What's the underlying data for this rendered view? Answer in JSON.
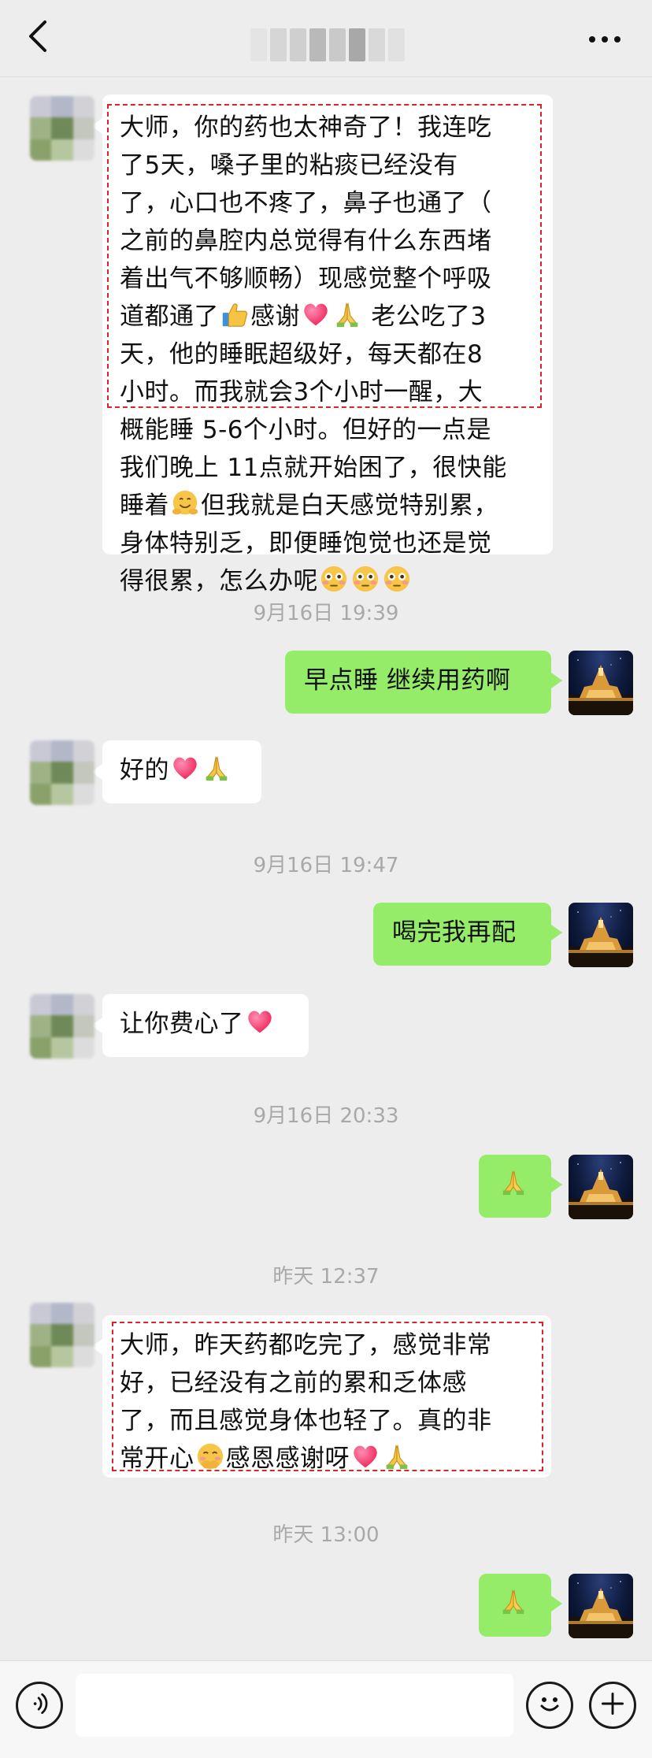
{
  "header": {
    "back_icon": "chevron-left-icon",
    "more_icon": "more-dots-icon",
    "title_blur_colors": [
      "#e4e4e4",
      "#d6d6d6",
      "#cfcfcf",
      "#b9b9b9",
      "#c9c9c9",
      "#a8a8a8",
      "#d9d9d9",
      "#e1e1e1"
    ]
  },
  "colors": {
    "incoming_bubble": "#ffffff",
    "outgoing_bubble": "#95ec69",
    "highlight_box": "#d8242b",
    "timestamp": "#a9a9a9",
    "background": "#ededed"
  },
  "messages": [
    {
      "direction": "in",
      "text_lines": [
        "大师，你的药也太神奇了！我连吃",
        "了5天，嗓子里的粘痰已经没有",
        "了，心口也不疼了，鼻子也通了（",
        "之前的鼻腔内总觉得有什么东西堵",
        "着出气不够顺畅）现感觉整个呼吸",
        "道都通了[thumbs-up]感谢[heart][pray] 老公吃了3",
        "天，他的睡眠超级好，每天都在8",
        "小时。而我就会3个小时一醒，大",
        "概能睡 5-6个小时。但好的一点是",
        "我们晚上 11点就开始困了，很快能",
        "睡着[hug]但我就是白天感觉特别累，",
        "身体特别乏，即便睡饱觉也还是觉",
        "得很累，怎么办呢[flushed][flushed][flushed]"
      ]
    },
    {
      "direction": "timestamp",
      "text": "9月16日 19:39"
    },
    {
      "direction": "out",
      "text": "早点睡 继续用药啊"
    },
    {
      "direction": "in",
      "text": "好的[heart][pray]"
    },
    {
      "direction": "timestamp",
      "text": "9月16日 19:47"
    },
    {
      "direction": "out",
      "text": "喝完我再配"
    },
    {
      "direction": "in",
      "text": "让你费心了[heart]"
    },
    {
      "direction": "timestamp",
      "text": "9月16日 20:33"
    },
    {
      "direction": "out",
      "text": "[pray]"
    },
    {
      "direction": "timestamp",
      "text": "昨天 12:37"
    },
    {
      "direction": "in",
      "text_lines": [
        "大师，昨天药都吃完了，感觉非常",
        "好，已经没有之前的累和乏体感",
        "了，而且感觉身体也轻了。真的非",
        "常开心[shy]感恩感谢呀[heart][pray]"
      ]
    },
    {
      "direction": "timestamp",
      "text": "昨天 13:00"
    },
    {
      "direction": "out",
      "text": "[pray]"
    }
  ],
  "inputbar": {
    "voice_icon": "voice-icon",
    "emoji_icon": "emoji-smile-icon",
    "plus_icon": "plus-icon",
    "input_value": ""
  },
  "avatar_incoming_colors": [
    "#c9c9d6",
    "#b2b8c8",
    "#d1d1d6",
    "#9fb286",
    "#6f8a58",
    "#c3c7bd",
    "#8aa26a",
    "#b6c7a0",
    "#dcdcdc"
  ]
}
